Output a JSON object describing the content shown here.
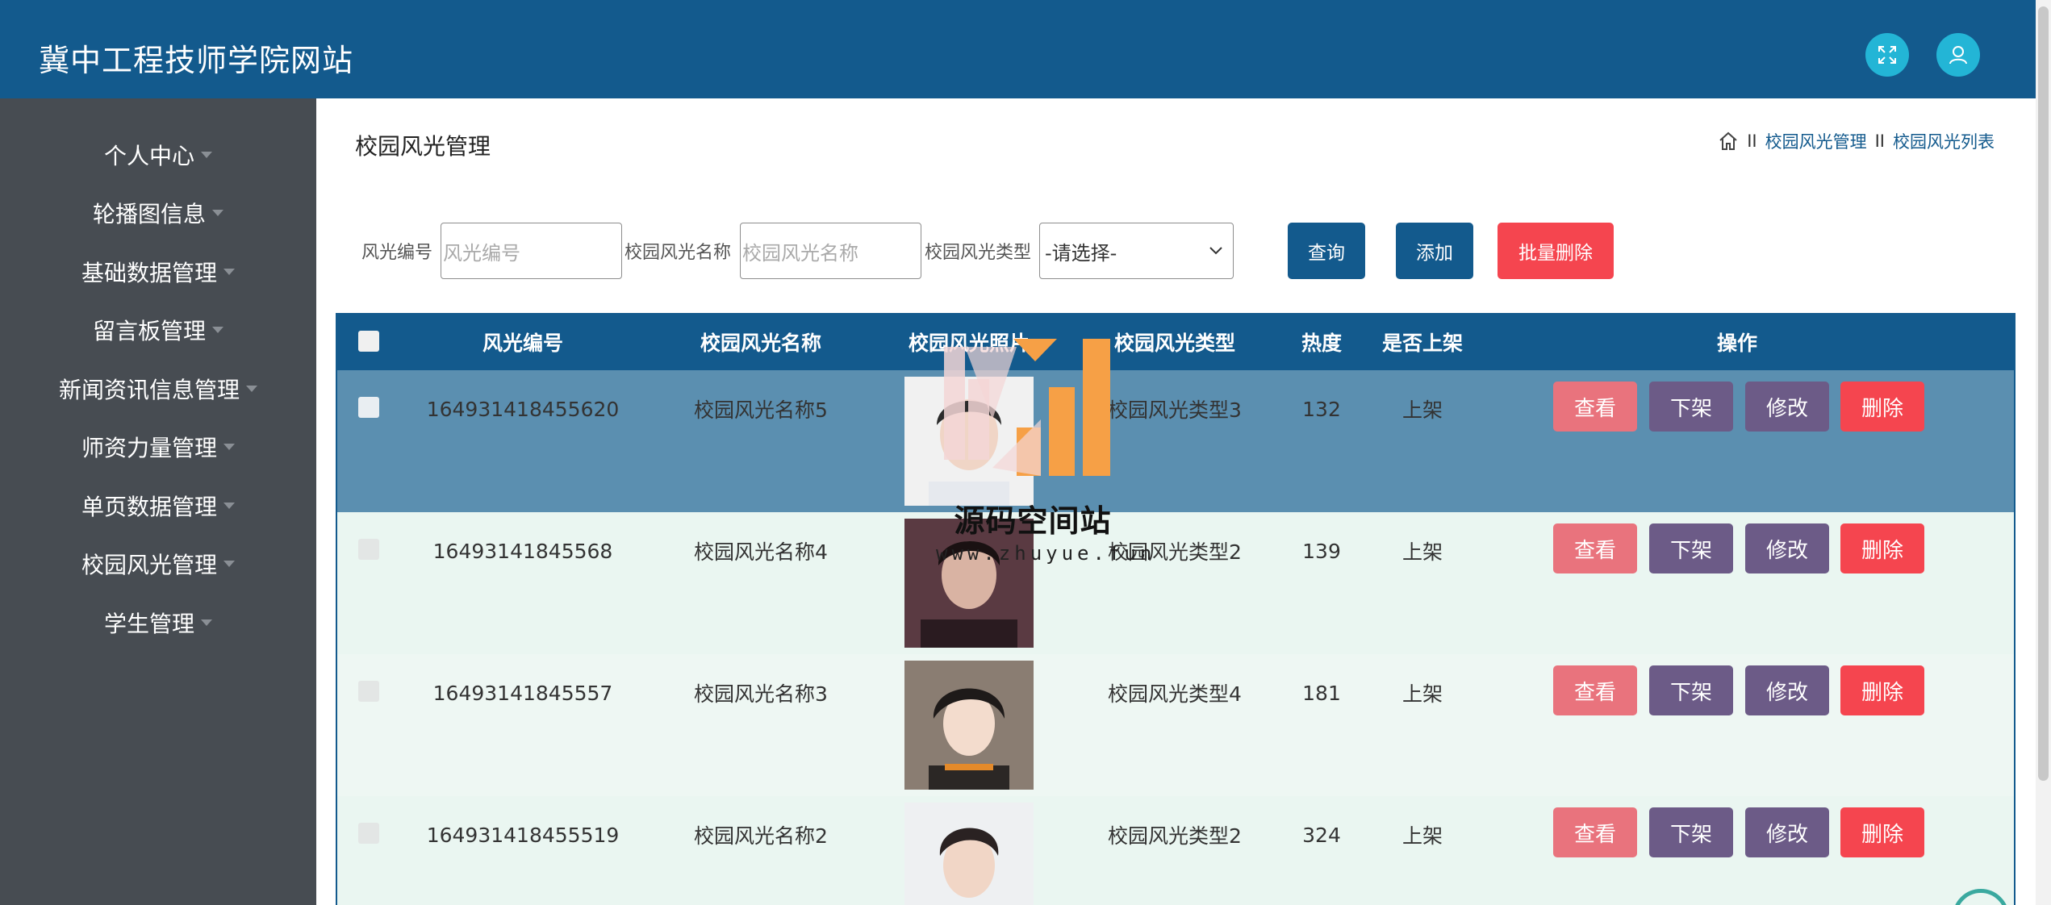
{
  "header": {
    "site_title": "冀中工程技师学院网站",
    "expand_icon": "expand-icon",
    "user_icon": "user-icon"
  },
  "sidebar": {
    "items": [
      {
        "label": "个人中心"
      },
      {
        "label": "轮播图信息"
      },
      {
        "label": "基础数据管理"
      },
      {
        "label": "留言板管理"
      },
      {
        "label": "新闻资讯信息管理"
      },
      {
        "label": "师资力量管理"
      },
      {
        "label": "单页数据管理"
      },
      {
        "label": "校园风光管理"
      },
      {
        "label": "学生管理"
      }
    ]
  },
  "page": {
    "title": "校园风光管理",
    "breadcrumb": [
      "校园风光管理",
      "校园风光列表"
    ],
    "breadcrumb_sep": "II"
  },
  "search": {
    "label_code": "风光编号",
    "placeholder_code": "风光编号",
    "label_name": "校园风光名称",
    "placeholder_name": "校园风光名称",
    "label_type": "校园风光类型",
    "type_selected": "-请选择-",
    "query_label": "查询",
    "add_label": "添加",
    "batch_delete_label": "批量删除"
  },
  "table": {
    "headers": [
      "风光编号",
      "校园风光名称",
      "校园风光照片",
      "校园风光类型",
      "热度",
      "是否上架",
      "操作"
    ],
    "rows": [
      {
        "code": "164931418455620",
        "name": "校园风光名称5",
        "type": "校园风光类型3",
        "heat": "132",
        "status": "上架"
      },
      {
        "code": "16493141845568",
        "name": "校园风光名称4",
        "type": "校园风光类型2",
        "heat": "139",
        "status": "上架"
      },
      {
        "code": "16493141845557",
        "name": "校园风光名称3",
        "type": "校园风光类型4",
        "heat": "181",
        "status": "上架"
      },
      {
        "code": "164931418455519",
        "name": "校园风光名称2",
        "type": "校园风光类型2",
        "heat": "324",
        "status": "上架"
      }
    ],
    "actions": {
      "view": "查看",
      "offshelf": "下架",
      "edit": "修改",
      "delete": "删除"
    }
  },
  "watermark": {
    "title": "源码空间站",
    "url": "www.zhuyue.fun"
  },
  "colors": {
    "primary": "#135a8d",
    "sidebar": "#474c52",
    "danger": "#f5454f",
    "view": "#e9737d",
    "purple": "#6c5b87",
    "header_icon": "#23b5d6"
  }
}
